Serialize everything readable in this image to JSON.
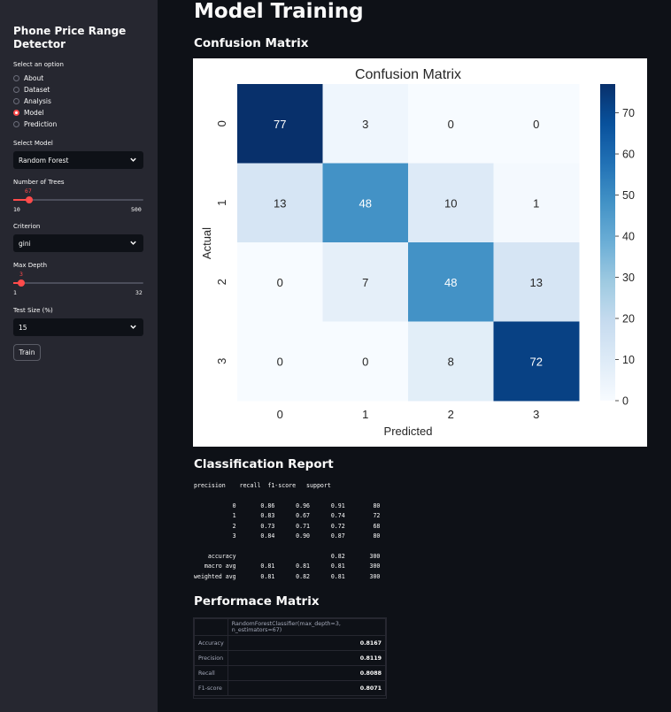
{
  "sidebar": {
    "title": "Phone Price Range Detector",
    "option_label": "Select an option",
    "options": [
      {
        "label": "About",
        "selected": false
      },
      {
        "label": "Dataset",
        "selected": false
      },
      {
        "label": "Analysis",
        "selected": false
      },
      {
        "label": "Model",
        "selected": true
      },
      {
        "label": "Prediction",
        "selected": false
      }
    ],
    "model_label": "Select Model",
    "model_value": "Random Forest",
    "trees_label": "Number of Trees",
    "trees_value": "67",
    "trees_min": "10",
    "trees_max": "500",
    "criterion_label": "Criterion",
    "criterion_value": "gini",
    "depth_label": "Max Depth",
    "depth_value": "3",
    "depth_min": "1",
    "depth_max": "32",
    "test_label": "Test Size (%)",
    "test_value": "15",
    "train_button": "Train"
  },
  "main": {
    "title": "Model Training",
    "cm_heading": "Confusion Matrix",
    "report_heading": "Classification Report",
    "perf_heading": "Performace Matrix",
    "report_lines": [
      "precision    recall  f1-score   support",
      "",
      "           0       0.86      0.96      0.91        80",
      "           1       0.83      0.67      0.74        72",
      "           2       0.73      0.71      0.72        68",
      "           3       0.84      0.90      0.87        80",
      "",
      "    accuracy                           0.82       300",
      "   macro avg       0.81      0.81      0.81       300",
      "weighted avg       0.81      0.82      0.81       300"
    ],
    "perf_table": {
      "header": "RandomForestClassifier(max_depth=3, n_estimators=67)",
      "rows": [
        {
          "label": "Accuracy",
          "value": "0.8167"
        },
        {
          "label": "Precision",
          "value": "0.8119"
        },
        {
          "label": "Recall",
          "value": "0.8088"
        },
        {
          "label": "F1-score",
          "value": "0.8071"
        }
      ]
    }
  },
  "colors": {
    "accent": "#ff4b4b",
    "cmap_low": "#f7fbff",
    "cmap_high": "#08306b"
  },
  "chart_data": {
    "type": "heatmap",
    "title": "Confusion Matrix",
    "xlabel": "Predicted",
    "ylabel": "Actual",
    "x_categories": [
      "0",
      "1",
      "2",
      "3"
    ],
    "y_categories": [
      "0",
      "1",
      "2",
      "3"
    ],
    "values": [
      [
        77,
        3,
        0,
        0
      ],
      [
        13,
        48,
        10,
        1
      ],
      [
        0,
        7,
        48,
        13
      ],
      [
        0,
        0,
        8,
        72
      ]
    ],
    "colorbar_ticks": [
      "0",
      "10",
      "20",
      "30",
      "40",
      "50",
      "60",
      "70"
    ],
    "colorbar_range": [
      0,
      77
    ],
    "colormap": "Blues"
  }
}
